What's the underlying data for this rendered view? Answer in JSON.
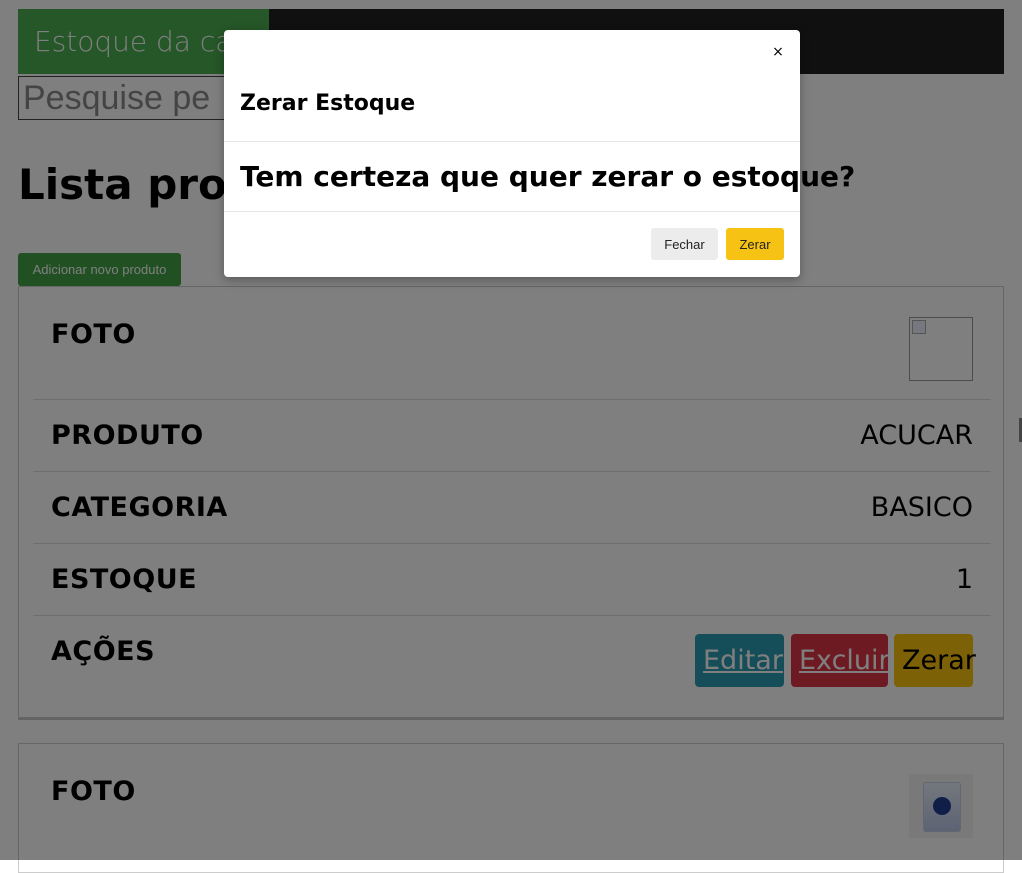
{
  "header": {
    "brand": "Estoque da cas",
    "search_value": "Pesquise pe"
  },
  "page": {
    "title": "Lista produ",
    "add_button": "Adicionar novo produto"
  },
  "product1": {
    "photo_label": "FOTO",
    "product_label": "PRODUTO",
    "product_value": "ACUCAR",
    "category_label": "CATEGORIA",
    "category_value": "BASICO",
    "stock_label": "ESTOQUE",
    "stock_value": "1",
    "actions_label": "AÇÕES",
    "edit": "Editar",
    "delete": "Excluir",
    "reset": "Zerar"
  },
  "product2": {
    "photo_label": "FOTO"
  },
  "modal": {
    "close_symbol": "×",
    "title": "Zerar Estoque",
    "body": "Tem certeza que quer zerar o estoque?",
    "cancel": "Fechar",
    "confirm": "Zerar"
  },
  "colors": {
    "brand": "#4caf50",
    "navbar": "#212121",
    "edit": "#2b9bb2",
    "delete": "#dc3545",
    "reset": "#fac30f"
  }
}
